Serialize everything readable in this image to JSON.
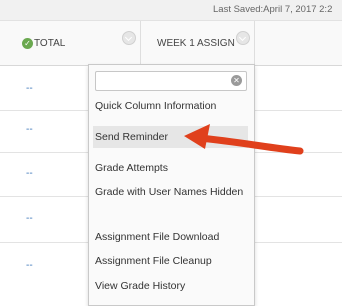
{
  "topbar": {
    "last_saved": "Last Saved:April 7, 2017 2:2"
  },
  "columns": [
    {
      "label": "TOTAL"
    },
    {
      "label": "WEEK 1 ASSIGN"
    }
  ],
  "rows": [
    {
      "total": "--"
    },
    {
      "total": "--"
    },
    {
      "total": "--"
    },
    {
      "total": "--"
    },
    {
      "total": "--"
    }
  ],
  "menu": {
    "search": {
      "value": ""
    },
    "items": [
      {
        "label": "Quick Column Information"
      },
      {
        "label": "Send Reminder"
      },
      {
        "label": "Grade Attempts"
      },
      {
        "label": "Grade with User Names Hidden"
      },
      {
        "label": "Assignment File Download"
      },
      {
        "label": "Assignment File Cleanup"
      },
      {
        "label": "View Grade History"
      }
    ]
  },
  "annotation": {
    "arrow_color": "#e0401c",
    "highlighted_item": "Send Reminder"
  },
  "colors": {
    "status_green": "#6aa84f",
    "link_blue": "#3a74b8",
    "menu_highlight": "#e6e6e6"
  },
  "icons": [
    "check-circle-icon",
    "chevron-down-icon",
    "clear-search-icon",
    "annotation-arrow"
  ]
}
